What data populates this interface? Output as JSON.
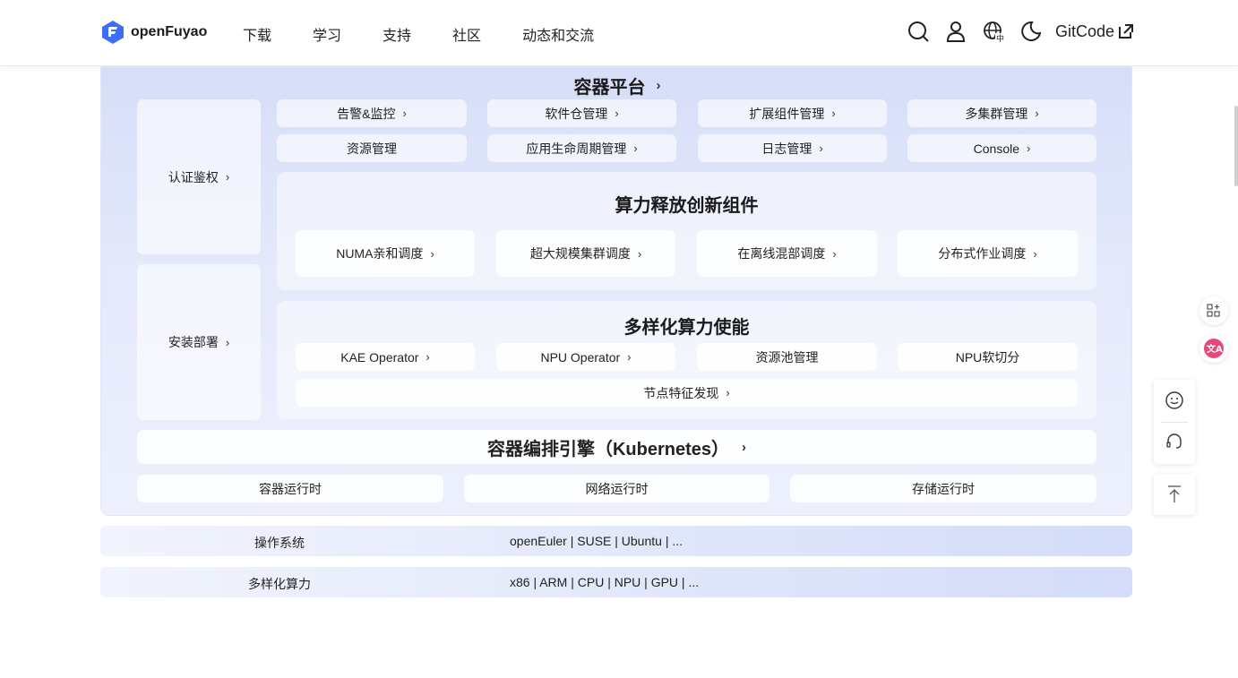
{
  "header": {
    "logo_text": "openFuyao",
    "nav": [
      "下载",
      "学习",
      "支持",
      "社区",
      "动态和交流"
    ],
    "gitcode_label": "GitCode"
  },
  "platform": {
    "title": "容器平台",
    "left": [
      "认证鉴权",
      "安装部署"
    ],
    "row1": [
      "告警&监控",
      "软件仓管理",
      "扩展组件管理",
      "多集群管理"
    ],
    "row2": [
      "资源管理",
      "应用生命周期管理",
      "日志管理",
      "Console"
    ]
  },
  "compute_release": {
    "title": "算力释放创新组件",
    "items": [
      "NUMA亲和调度",
      "超大规模集群调度",
      "在离线混部调度",
      "分布式作业调度"
    ]
  },
  "diverse_compute": {
    "title": "多样化算力使能",
    "items": [
      "KAE Operator",
      "NPU Operator",
      "资源池管理",
      "NPU软切分"
    ],
    "node": "节点特征发现"
  },
  "k8s": {
    "title": "容器编排引擎（Kubernetes）",
    "runtimes": [
      "容器运行时",
      "网络运行时",
      "存储运行时"
    ]
  },
  "rows": [
    {
      "label": "操作系统",
      "value": "openEuler | SUSE | Ubuntu | ..."
    },
    {
      "label": "多样化算力",
      "value": "x86 | ARM | CPU | NPU | GPU | ..."
    }
  ],
  "colors": {
    "brand": "#3e6ef5",
    "panel": "#d6def8",
    "translate": "#e8477a"
  },
  "icons": [
    "search-icon",
    "user-icon",
    "language-icon",
    "moon-icon",
    "external-link-icon",
    "apps-icon",
    "translate-icon",
    "smile-icon",
    "headset-icon",
    "back-to-top-icon"
  ]
}
